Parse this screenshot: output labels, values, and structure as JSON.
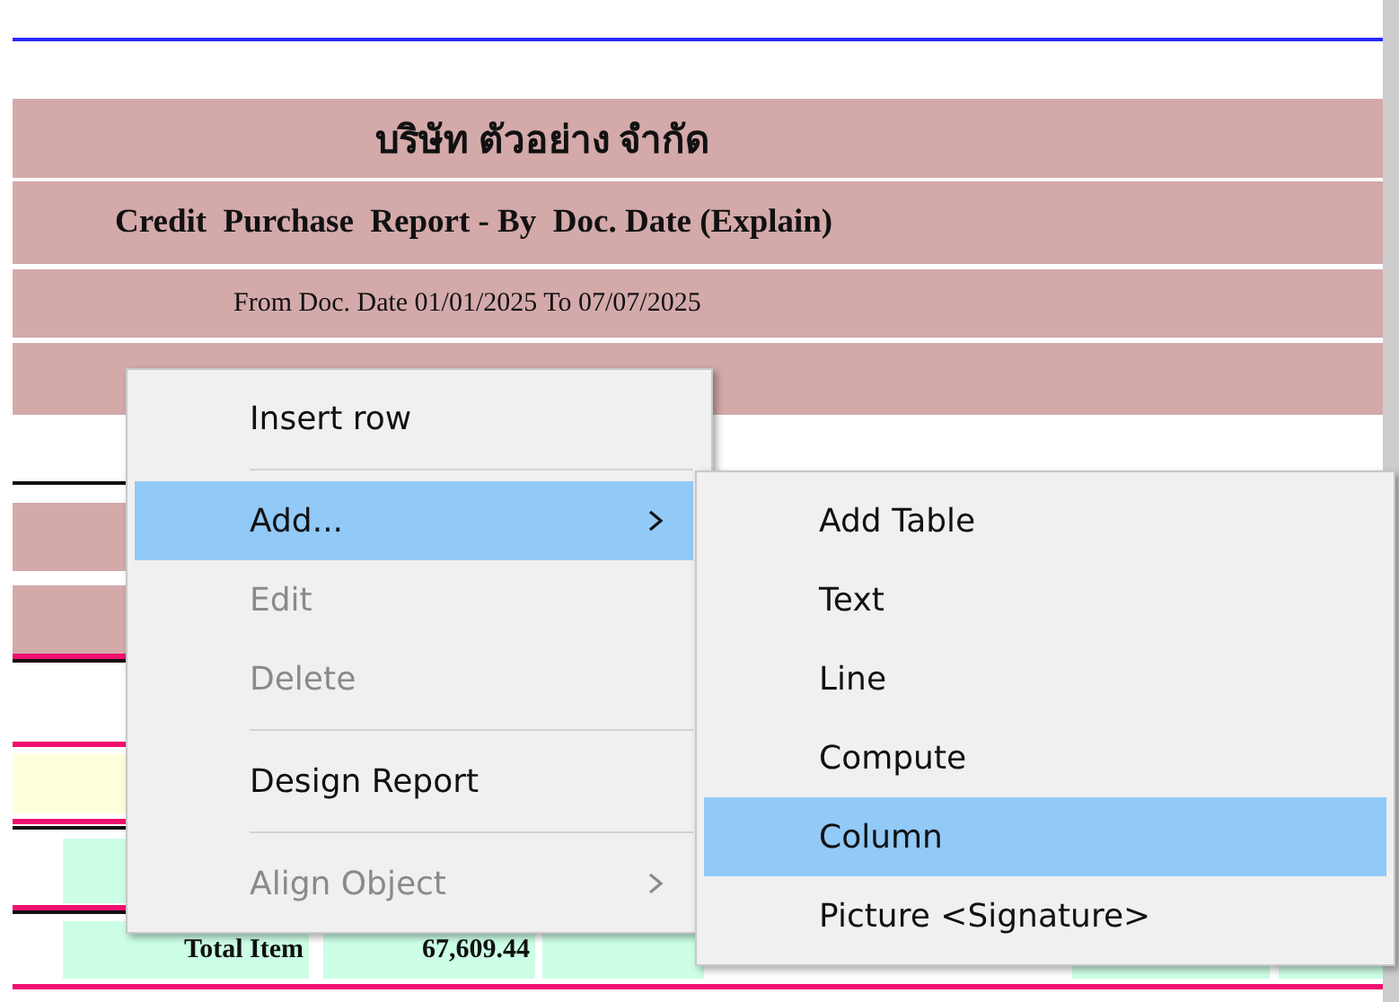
{
  "report": {
    "company": "บริษัท ตัวอย่าง จำกัด",
    "title": "Credit  Purchase  Report - By  Doc. Date (Explain)",
    "date_range": "From Doc. Date 01/01/2025 To 07/07/2025"
  },
  "total_row": {
    "label": "Total Item",
    "amount": "67,609.44"
  },
  "context_menu": {
    "items": [
      {
        "kind": "item",
        "label": "Insert row",
        "selected": false,
        "disabled": false,
        "has_submenu": false
      },
      {
        "kind": "separator"
      },
      {
        "kind": "item",
        "label": "Add...",
        "selected": true,
        "disabled": false,
        "has_submenu": true
      },
      {
        "kind": "item",
        "label": "Edit",
        "selected": false,
        "disabled": true,
        "has_submenu": false
      },
      {
        "kind": "item",
        "label": "Delete",
        "selected": false,
        "disabled": true,
        "has_submenu": false
      },
      {
        "kind": "separator"
      },
      {
        "kind": "item",
        "label": "Design Report",
        "selected": false,
        "disabled": false,
        "has_submenu": false
      },
      {
        "kind": "separator"
      },
      {
        "kind": "item",
        "label": "Align Object",
        "selected": false,
        "disabled": true,
        "has_submenu": true
      }
    ]
  },
  "submenu": {
    "items": [
      {
        "label": "Add Table",
        "selected": false
      },
      {
        "label": "Text",
        "selected": false
      },
      {
        "label": "Line",
        "selected": false
      },
      {
        "label": "Compute",
        "selected": false
      },
      {
        "label": "Column",
        "selected": true
      },
      {
        "label": "Picture <Signature>",
        "selected": false
      }
    ]
  }
}
